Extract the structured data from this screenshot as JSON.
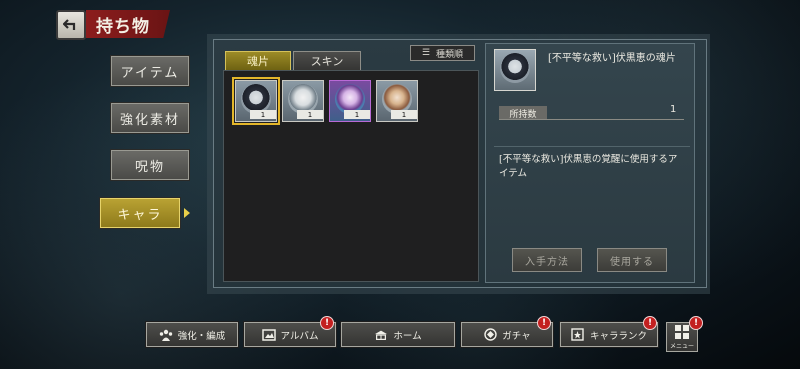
{
  "header": {
    "title": "持ち物",
    "back_icon": "back-arrow-icon"
  },
  "sidebar": {
    "items": [
      {
        "label": "アイテム",
        "active": false
      },
      {
        "label": "強化素材",
        "active": false
      },
      {
        "label": "呪物",
        "active": false
      },
      {
        "label": "キャラ",
        "active": true
      }
    ]
  },
  "tabs": [
    {
      "label": "魂片",
      "active": true
    },
    {
      "label": "スキン",
      "active": false
    }
  ],
  "sort": {
    "label": "種類順",
    "icon": "sort-list-icon"
  },
  "items": [
    {
      "count": "1",
      "selected": true,
      "frame_color": "#5f6d78"
    },
    {
      "count": "1",
      "selected": false,
      "frame_color": "#8d9aa3"
    },
    {
      "count": "1",
      "selected": false,
      "frame_color": "#8a3fb0"
    },
    {
      "count": "1",
      "selected": false,
      "frame_color": "#b08a70"
    }
  ],
  "detail": {
    "name": "[不平等な救い]伏黒恵の魂片",
    "quantity_label": "所持数",
    "quantity_value": "1",
    "description": "[不平等な救い]伏黒恵の覚醒に使用するアイテム",
    "acquire_label": "入手方法",
    "use_label": "使用する"
  },
  "bottom_nav": [
    {
      "label": "強化・編成",
      "icon": "party-icon",
      "badge": ""
    },
    {
      "label": "アルバム",
      "icon": "album-icon",
      "badge": "!"
    },
    {
      "label": "ホーム",
      "icon": "home-icon",
      "badge": ""
    },
    {
      "label": "ガチャ",
      "icon": "gacha-icon",
      "badge": "!"
    },
    {
      "label": "キャラランク",
      "icon": "rank-icon",
      "badge": "!"
    }
  ],
  "menu": {
    "label": "メニュー",
    "badge": "!"
  },
  "colors": {
    "accent_gold": "#b9a233",
    "title_red": "#8c1d1d",
    "badge_red": "#c32020"
  }
}
